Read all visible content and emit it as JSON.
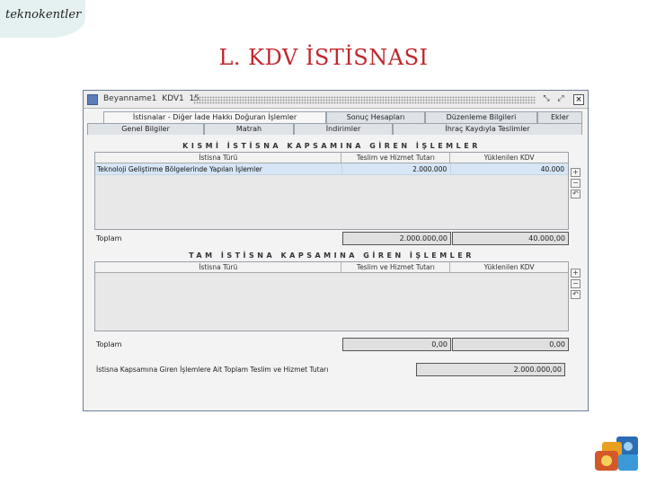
{
  "corner_tag": "teknokentler",
  "slide_title": "L. KDV İSTİSNASI",
  "window": {
    "title": "Beyanname1  KDV1  15",
    "icons": [
      "app-icon",
      "restore-icon",
      "maximize-icon",
      "close-icon"
    ]
  },
  "tabs_row1": [
    {
      "label": "İstisnalar - Diğer İade Hakkı Doğuran İşlemler",
      "active": true
    },
    {
      "label": "Sonuç Hesapları",
      "active": false
    },
    {
      "label": "Düzenleme Bilgileri",
      "active": false
    },
    {
      "label": "Ekler",
      "active": false
    }
  ],
  "tabs_row2": [
    {
      "label": "Genel Bilgiler"
    },
    {
      "label": "Matrah"
    },
    {
      "label": "İndirimler"
    },
    {
      "label": "İhraç Kaydıyla Teslimler"
    }
  ],
  "partial": {
    "title": "KISMİ İSTİSNA KAPSAMINA GİREN İŞLEMLER",
    "columns": [
      "İstisna Türü",
      "Teslim ve Hizmet Tutarı",
      "Yüklenilen KDV"
    ],
    "rows": [
      {
        "type": "Teknoloji Geliştirme Bölgelerinde Yapılan İşlemler",
        "amount": "2.000.000",
        "vat": "40.000"
      }
    ],
    "total_label": "Toplam",
    "total_amount": "2.000.000,00",
    "total_vat": "40.000,00"
  },
  "full": {
    "title": "TAM İSTİSNA KAPSAMINA GİREN İŞLEMLER",
    "columns": [
      "İstisna Türü",
      "Teslim ve Hizmet Tutarı",
      "Yüklenilen KDV"
    ],
    "total_label": "Toplam",
    "total_amount": "0,00",
    "total_vat": "0,00"
  },
  "final": {
    "label": "İstisna Kapsamına Giren İşlemlere Ait Toplam Teslim ve Hizmet Tutarı",
    "value": "2.000.000,00"
  },
  "side_buttons": [
    "add-row-icon",
    "remove-row-icon",
    "undo-icon"
  ],
  "colors": {
    "title": "#c0282e",
    "selected_row": "#d6e6f7",
    "corner_tag": "#e4f1f0"
  }
}
